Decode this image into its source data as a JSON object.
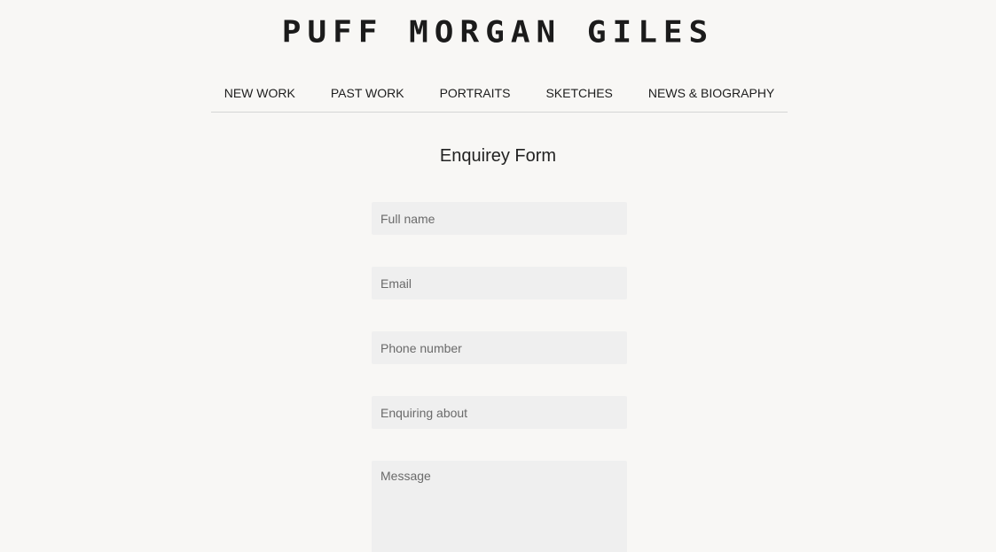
{
  "site": {
    "logo_text": "PUFF MORGAN GILES"
  },
  "nav": {
    "items": [
      {
        "label": "NEW WORK"
      },
      {
        "label": "PAST WORK"
      },
      {
        "label": "PORTRAITS"
      },
      {
        "label": "SKETCHES"
      },
      {
        "label": "NEWS & BIOGRAPHY"
      }
    ]
  },
  "form": {
    "title": "Enquirey Form",
    "full_name": {
      "value": "",
      "placeholder": "Full name"
    },
    "email": {
      "value": "",
      "placeholder": "Email"
    },
    "phone": {
      "value": "",
      "placeholder": "Phone number"
    },
    "enquiring_about": {
      "value": "",
      "placeholder": "Enquiring about"
    },
    "message": {
      "value": "",
      "placeholder": "Message"
    }
  },
  "colors": {
    "background": "#f8f7f5",
    "field_background": "#efefef",
    "text": "#222222",
    "placeholder": "#6a6a6a",
    "divider": "#d5d5d5"
  }
}
